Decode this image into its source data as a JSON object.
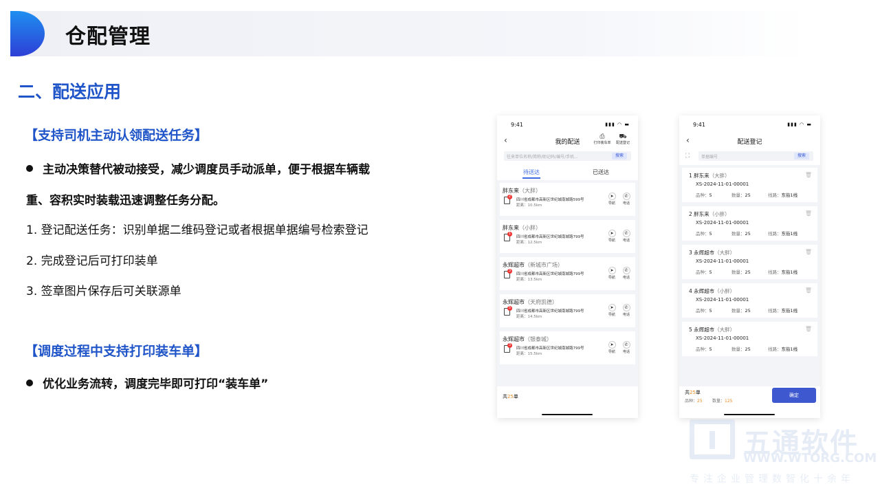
{
  "header": {
    "title": "仓配管理"
  },
  "section_title": "二、配送应用",
  "feature1": {
    "heading": "【支持司机主动认领配送任务】",
    "bullet_line1": "主动决策替代被动接受，减少调度员手动派单，便于根据车辆载",
    "bullet_line2": "重、容积实时装载迅速调整任务分配。",
    "items": [
      "1. 登记配送任务：识别单据二维码登记或者根据单据编号检索登记",
      "2. 完成登记后可打印装单",
      "3. 签章图片保存后可关联源单"
    ]
  },
  "feature2": {
    "heading": "【调度过程中支持打印装车单】",
    "bullet": "优化业务流转，调度完毕即可打印“装车单”"
  },
  "phone1": {
    "time": "9:41",
    "signal": "▮▮▮ ◠ ▬",
    "title": "我的配送",
    "action1": "打印装车单",
    "action2": "配送登记",
    "search_placeholder": "往来单位名称/简称/助记码/编号/手机...",
    "search_button": "搜索",
    "tab_pending": "待送达",
    "tab_done": "已送达",
    "nav_label": "导航",
    "call_label": "电话",
    "orders": [
      {
        "name": "胖东来",
        "branch": "（大胖）",
        "badge": "2",
        "address": "四川省成都市高新区世纪城南城路599号",
        "distance": "距离：10.5km"
      },
      {
        "name": "胖东来",
        "branch": "（小胖）",
        "badge": "1",
        "address": "四川省成都市高新区世纪城南城路799号",
        "distance": "距离：12.5km"
      },
      {
        "name": "永辉超市",
        "branch": "（新城市广场）",
        "badge": "3",
        "address": "四川省成都市高新区世纪城南城路799号",
        "distance": "距离：13.5km"
      },
      {
        "name": "永辉超市",
        "branch": "（天府凯德）",
        "badge": "5",
        "address": "四川省成都市高新区世纪城南城路799号",
        "distance": "距离：14.5km"
      },
      {
        "name": "永辉超市",
        "branch": "（银泰城）",
        "badge": "3",
        "address": "四川省成都市高新区世纪城南城路799号",
        "distance": "距离：15.5km"
      }
    ],
    "total_prefix": "共",
    "total_count": "25",
    "total_suffix": "单"
  },
  "phone2": {
    "time": "9:41",
    "signal": "▮▮▮ ◠ ▬",
    "title": "配送登记",
    "search_placeholder": "单据编号",
    "search_button": "搜索",
    "kinds_label": "品种：",
    "qty_label": "数量：",
    "route_label": "线路：",
    "records": [
      {
        "index": "1",
        "name": "胖东来",
        "branch": "（大胖）",
        "code": "XS-2024-11-01-00001",
        "kinds": "5",
        "qty": "25",
        "route": "东街1线"
      },
      {
        "index": "2",
        "name": "胖东来",
        "branch": "（小胖）",
        "code": "XS-2024-11-01-00001",
        "kinds": "5",
        "qty": "25",
        "route": "东街1线"
      },
      {
        "index": "3",
        "name": "永辉超市",
        "branch": "（大胖）",
        "code": "XS-2024-11-01-00001",
        "kinds": "5",
        "qty": "25",
        "route": "东街1线"
      },
      {
        "index": "4",
        "name": "永辉超市",
        "branch": "（小胖）",
        "code": "XS-2024-11-01-00001",
        "kinds": "5",
        "qty": "25",
        "route": "东街1线"
      },
      {
        "index": "5",
        "name": "永辉超市",
        "branch": "（大胖）",
        "code": "XS-2024-11-01-00001",
        "kinds": "5",
        "qty": "25",
        "route": "东街1线"
      }
    ],
    "total_prefix": "共",
    "total_count": "25",
    "total_suffix": "单",
    "footer_kinds": "25",
    "footer_qty": "125",
    "confirm_button": "确定"
  },
  "watermark": {
    "cn": "五通软件",
    "en": "WWW.WTORG.COM",
    "slogan": "专注企业管理数智化十余年"
  }
}
